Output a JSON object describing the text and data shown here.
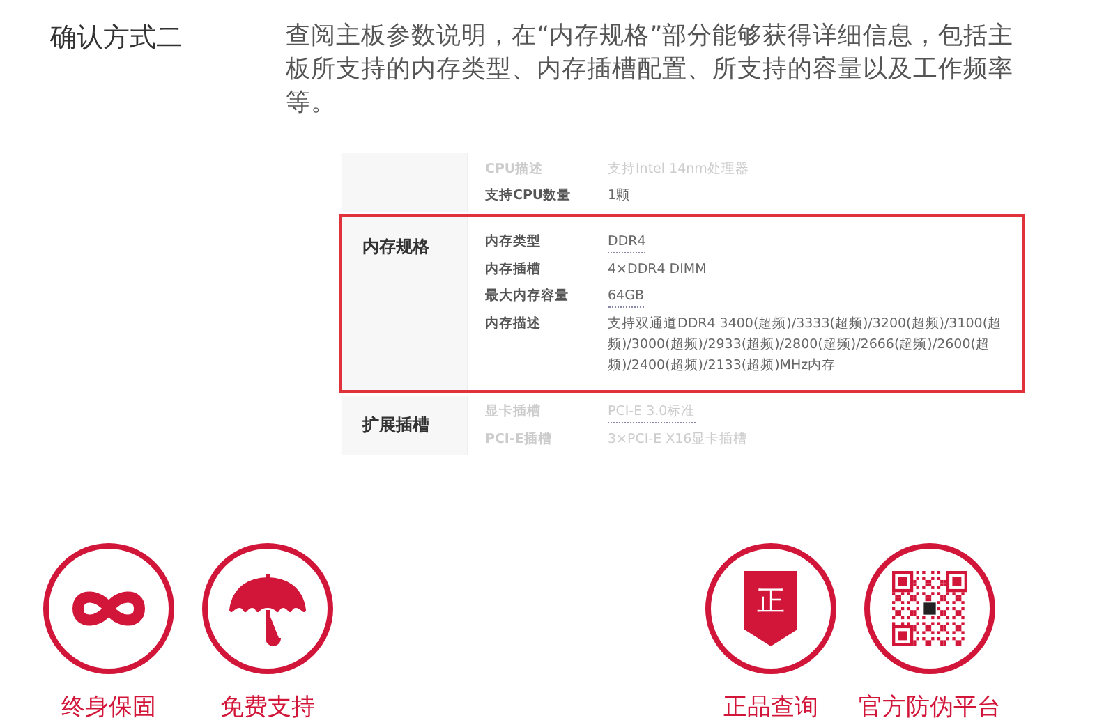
{
  "method": {
    "title": "确认方式二",
    "description": "查阅主板参数说明，在“内存规格”部分能够获得详细信息，包括主板所支持的内存类型、内存插槽配置、所支持的容量以及工作频率等。"
  },
  "spec_table": {
    "sections": [
      {
        "highlighted": false,
        "rows": [
          {
            "key": "CPU描述",
            "value": "支持Intel 14nm处理器",
            "underlined": false,
            "faded": true
          },
          {
            "key": "支持CPU数量",
            "value": "1颗",
            "underlined": false,
            "faded": false
          }
        ]
      },
      {
        "heading": "内存规格",
        "highlighted": true,
        "rows": [
          {
            "key": "内存类型",
            "value": "DDR4",
            "underlined": true,
            "faded": false
          },
          {
            "key": "内存插槽",
            "value": "4×DDR4 DIMM",
            "underlined": false,
            "faded": false
          },
          {
            "key": "最大内存容量",
            "value": "64GB",
            "underlined": true,
            "faded": false
          },
          {
            "key": "内存描述",
            "value": "支持双通道DDR4 3400(超频)/3333(超频)/3200(超频)/3100(超频)/3000(超频)/2933(超频)/2800(超频)/2666(超频)/2600(超频)/2400(超频)/2133(超频)MHz内存",
            "underlined": false,
            "faded": false
          }
        ]
      },
      {
        "heading": "扩展插槽",
        "highlighted": false,
        "rows": [
          {
            "key": "显卡插槽",
            "value": "PCI-E 3.0标准",
            "underlined": true,
            "faded": true
          },
          {
            "key": "PCI-E插槽",
            "value": "3×PCI-E X16显卡插槽",
            "underlined": false,
            "faded": true
          }
        ]
      }
    ]
  },
  "services": [
    {
      "kind": "infinity",
      "label": "终身保固"
    },
    {
      "kind": "umbrella",
      "label": "免费支持"
    },
    {
      "kind": "spacer"
    },
    {
      "kind": "shield",
      "label": "正品查询",
      "glyph": "正"
    },
    {
      "kind": "qr",
      "label": "官方防伪平台"
    }
  ]
}
